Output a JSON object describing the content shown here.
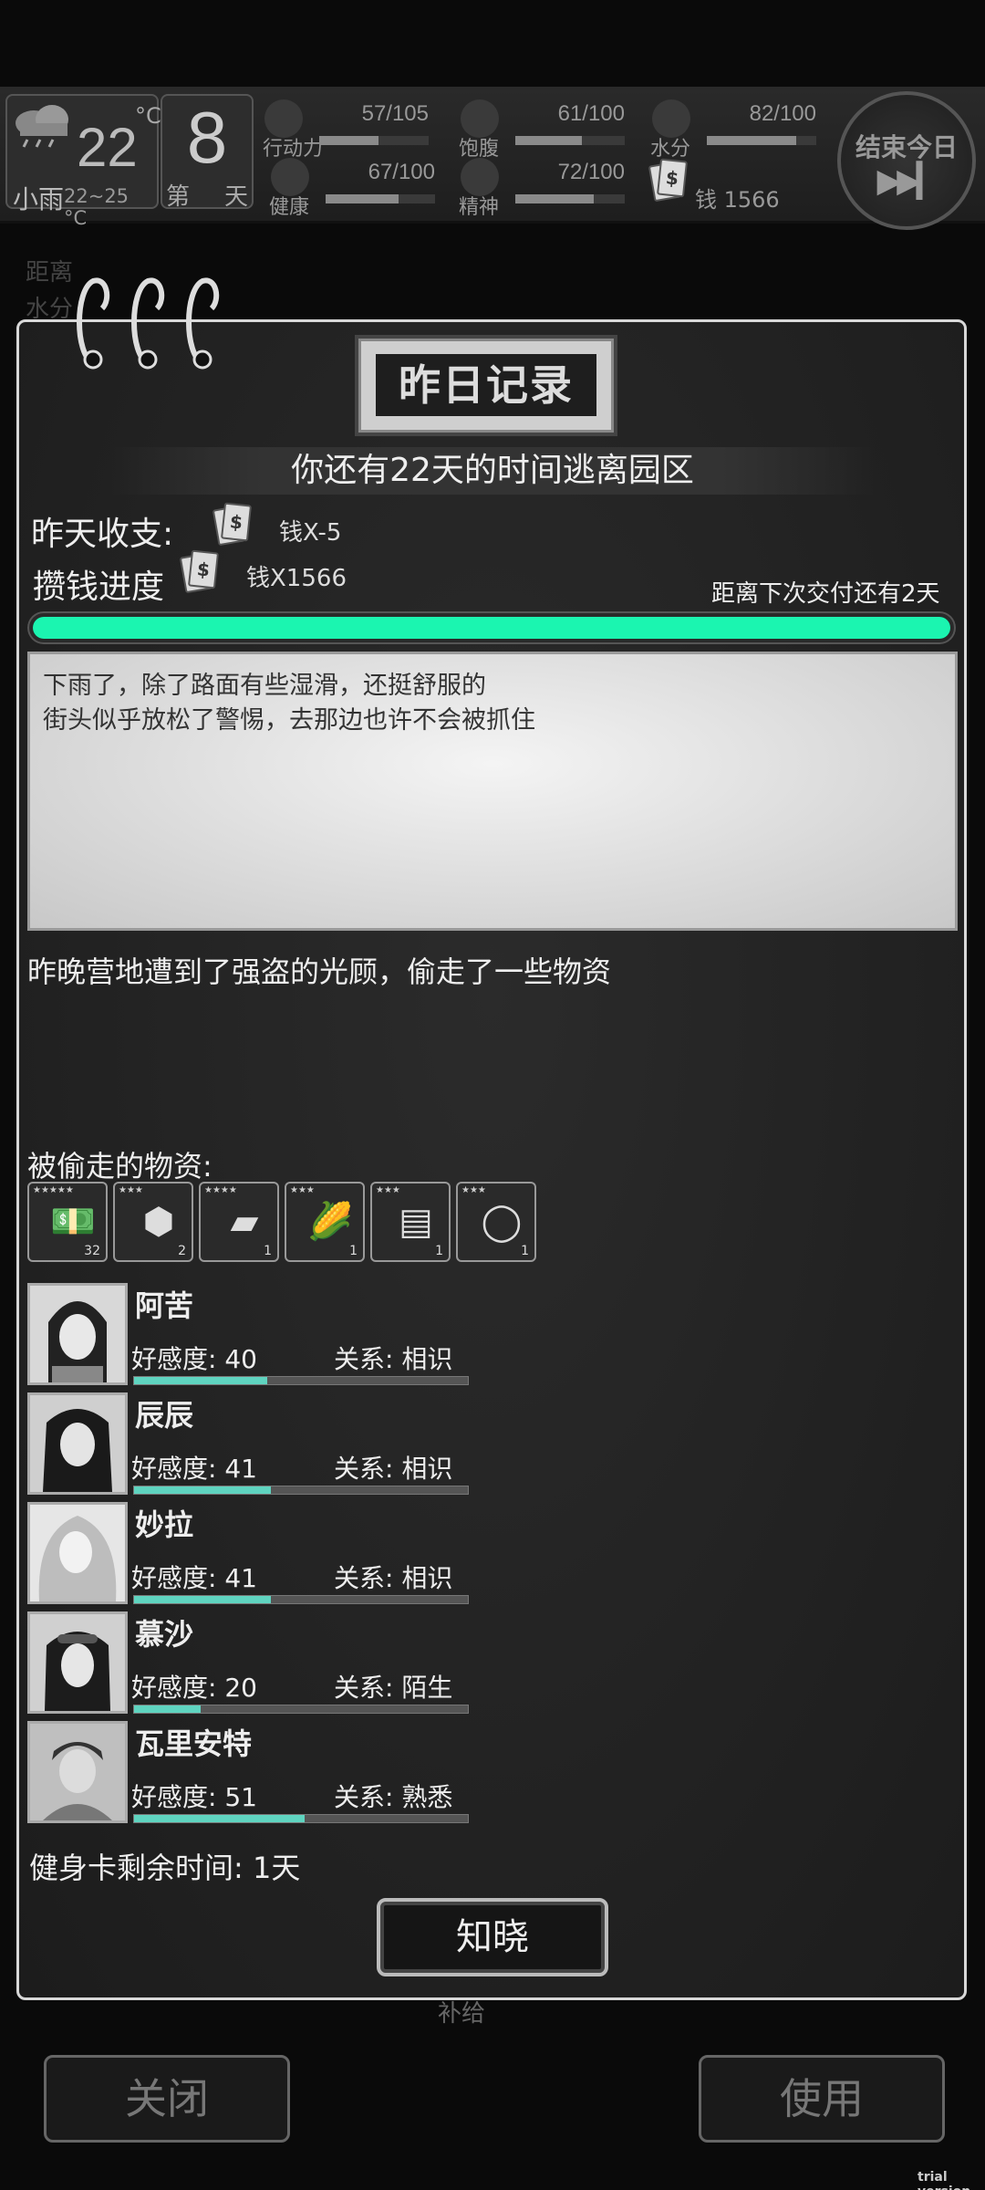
{
  "hud": {
    "temperature": "22",
    "temp_unit": "°C",
    "weather": "小雨",
    "temp_range": "22~25 °C",
    "day_number": "8",
    "day_prefix": "第",
    "day_suffix": "天",
    "stats": [
      {
        "label": "行动力",
        "value": "57/105",
        "fraction": 0.54,
        "icon": "footprint-icon"
      },
      {
        "label": "饱腹",
        "value": "61/100",
        "fraction": 0.61,
        "icon": "stomach-icon"
      },
      {
        "label": "水分",
        "value": "82/100",
        "fraction": 0.82,
        "icon": "water-drop-icon"
      },
      {
        "label": "健康",
        "value": "67/100",
        "fraction": 0.67,
        "icon": "health-cross-icon"
      },
      {
        "label": "精神",
        "value": "72/100",
        "fraction": 0.72,
        "icon": "brain-icon"
      }
    ],
    "money": "钱 1566",
    "end_day_label": "结束今日",
    "end_day_icon": "fast-forward-icon"
  },
  "background": {
    "line1": "距离",
    "line2": "水分",
    "supply": "补给"
  },
  "dialog": {
    "title": "昨日记录",
    "escape_notice": "你还有22天的时间逃离园区",
    "income_label": "昨天收支:",
    "income_value": "钱X-5",
    "savings_label": "攒钱进度",
    "savings_value": "钱X1566",
    "next_payment": "距离下次交付还有2天",
    "savings_progress": 1.0,
    "progress_color": "#1bf5b0",
    "note_lines": [
      "下雨了，除了路面有些湿滑，还挺舒服的",
      "街头似乎放松了警惕，去那边也许不会被抓住"
    ],
    "event": "昨晚营地遭到了强盗的光顾，偷走了一些物资",
    "stolen_label": "被偷走的物资:",
    "stolen_items": [
      {
        "icon": "cash-icon",
        "qty": "32"
      },
      {
        "icon": "ore-icon",
        "qty": "2"
      },
      {
        "icon": "metal-bar-icon",
        "qty": "1"
      },
      {
        "icon": "corn-icon",
        "qty": "1"
      },
      {
        "icon": "ticket-icon",
        "qty": "1"
      },
      {
        "icon": "ring-icon",
        "qty": "1"
      }
    ],
    "npcs": [
      {
        "name": "阿苦",
        "favor": "好感度: 40",
        "favor_value": 40,
        "relation": "关系: 相识"
      },
      {
        "name": "辰辰",
        "favor": "好感度: 41",
        "favor_value": 41,
        "relation": "关系: 相识"
      },
      {
        "name": "妙拉",
        "favor": "好感度: 41",
        "favor_value": 41,
        "relation": "关系: 相识"
      },
      {
        "name": "慕沙",
        "favor": "好感度: 20",
        "favor_value": 20,
        "relation": "关系: 陌生"
      },
      {
        "name": "瓦里安特",
        "favor": "好感度: 51",
        "favor_value": 51,
        "relation": "关系: 熟悉"
      }
    ],
    "favor_color": "#5fd4c0",
    "gym_card": "健身卡剩余时间: 1天",
    "ack_button": "知晓"
  },
  "bottom": {
    "close_button": "关闭",
    "use_button": "使用"
  },
  "watermark": "trial version"
}
